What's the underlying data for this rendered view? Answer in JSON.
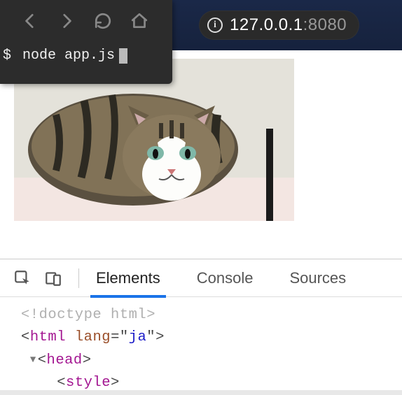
{
  "browser": {
    "url_host": "127.0.0.1",
    "url_port": ":8080"
  },
  "terminal": {
    "prompt": "$",
    "command": "node app.js"
  },
  "devtools": {
    "tabs": {
      "elements": "Elements",
      "console": "Console",
      "sources": "Sources"
    },
    "code": {
      "doctype": "<!doctype html>",
      "html_open_lt": "<",
      "html_tag": "html",
      "html_space": " ",
      "html_attr": "lang",
      "html_eq": "=\"",
      "html_val": "ja",
      "html_close": "\">",
      "head_open_lt": "<",
      "head_tag": "head",
      "head_gt": ">",
      "style_open_lt": "<",
      "style_tag": "style",
      "style_gt": ">"
    }
  }
}
